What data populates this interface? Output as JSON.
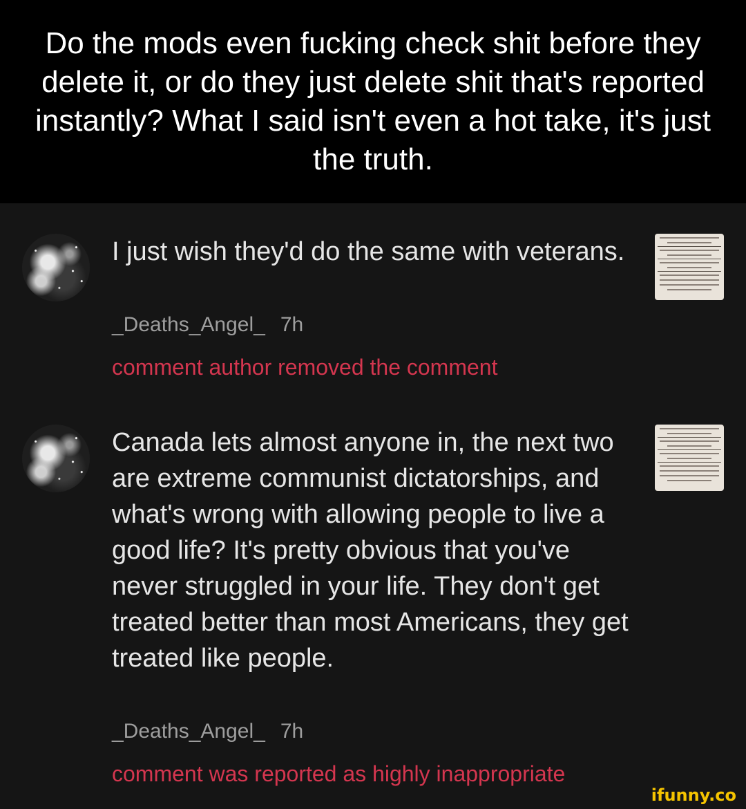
{
  "header": {
    "title": "Do the mods even fucking check shit before they delete it, or do they just delete shit that's reported instantly? What I said isn't even a hot take, it's just the truth."
  },
  "comments": [
    {
      "text": "I just wish they'd do the same with veterans.",
      "author": "_Deaths_Angel_",
      "time": "7h",
      "status": "comment author removed the comment"
    },
    {
      "text": "Canada lets almost anyone in, the next two are extreme communist dictatorships, and what's wrong with allowing people to live a good life? It's pretty obvious that you've never struggled in your life. They don't get treated better than most Americans, they get treated like people.",
      "author": "_Deaths_Angel_",
      "time": "7h",
      "status": "comment was reported as highly inappropriate"
    }
  ],
  "watermark": "ifunny.co",
  "colors": {
    "background": "#151515",
    "header_background": "#000000",
    "status_red": "#d4364f",
    "meta_gray": "#9e9e9e",
    "watermark_yellow": "#f5c400"
  },
  "icons": [
    "avatar-image",
    "meme-thumbnail-image"
  ]
}
